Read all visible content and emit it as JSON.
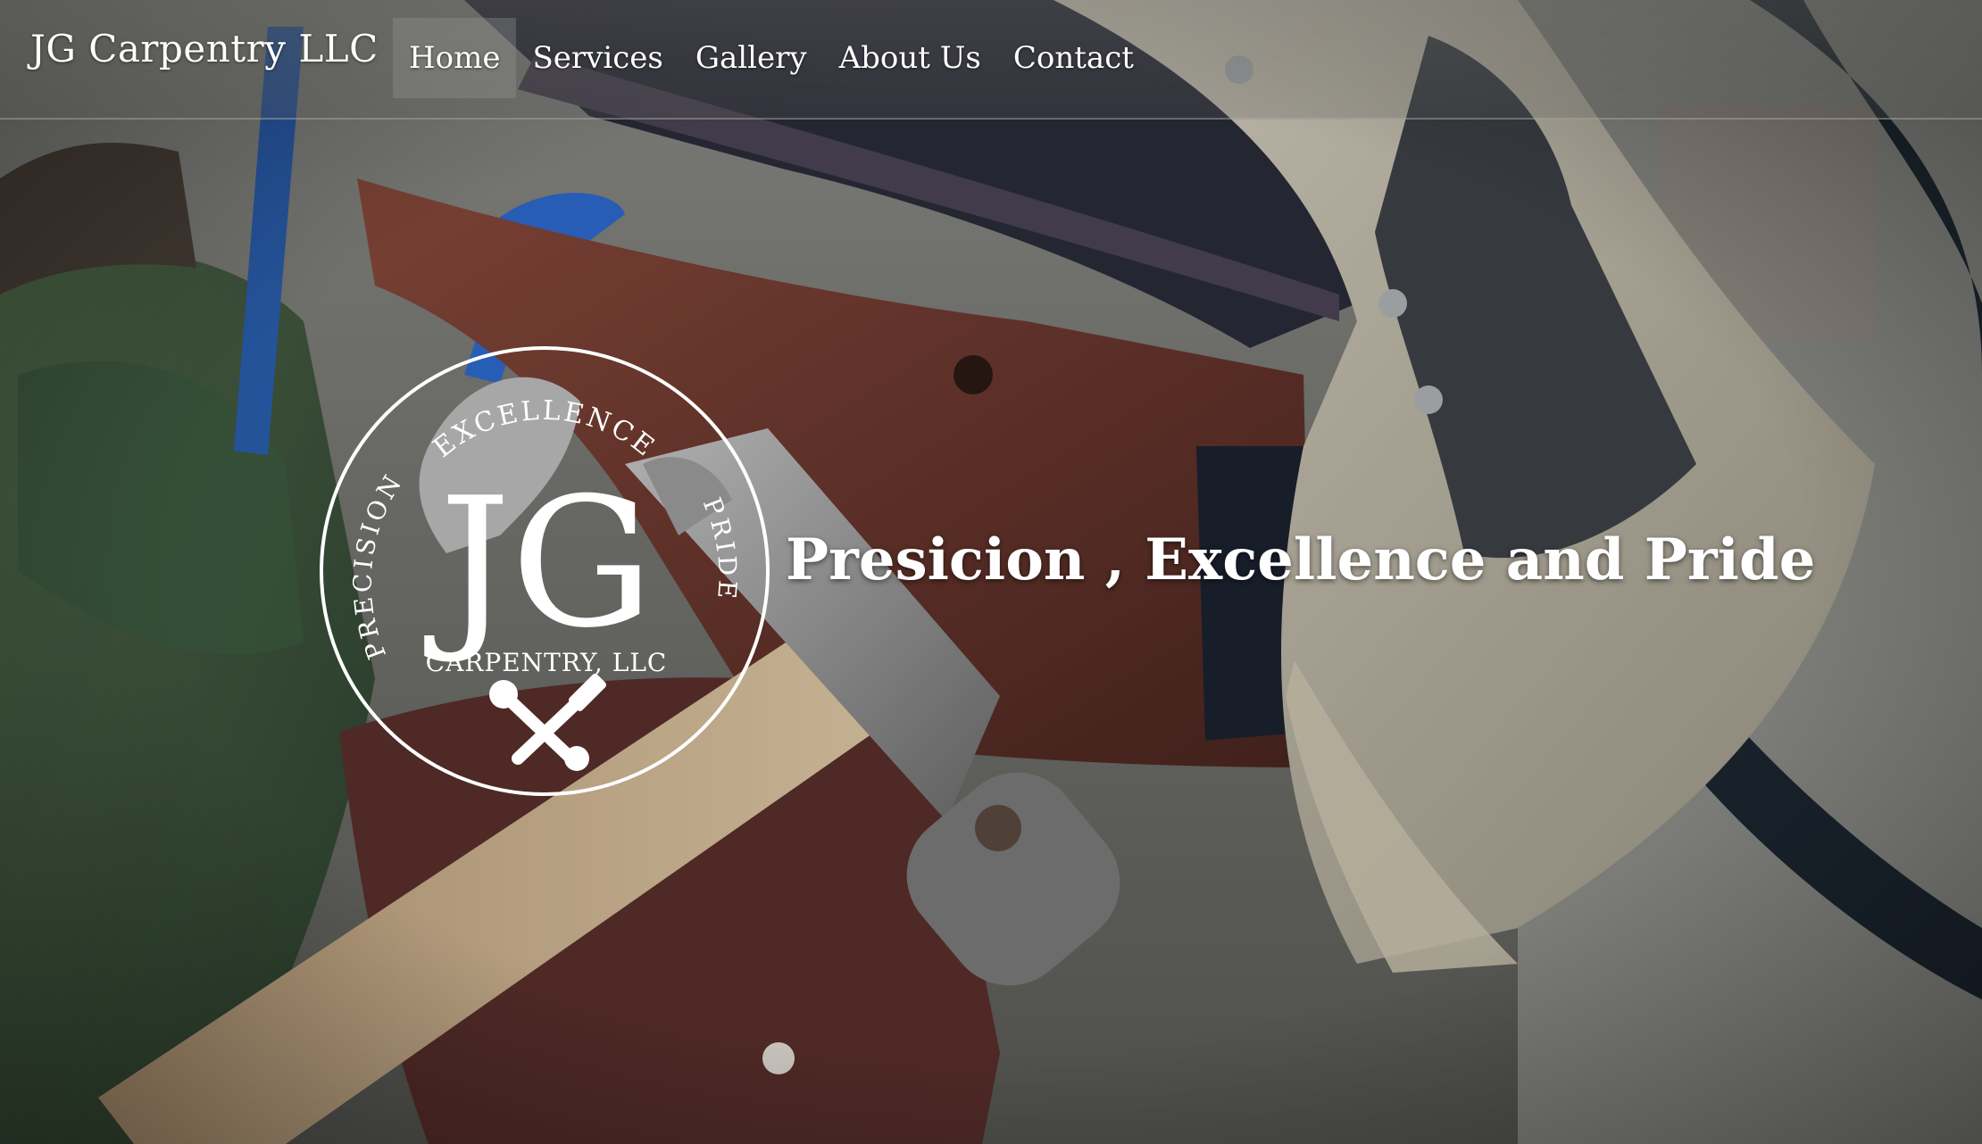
{
  "site": {
    "brand": "JG Carpentry LLC"
  },
  "nav": {
    "items": [
      {
        "label": "Home",
        "active": true
      },
      {
        "label": "Services",
        "active": false
      },
      {
        "label": "Gallery",
        "active": false
      },
      {
        "label": "About Us",
        "active": false
      },
      {
        "label": "Contact",
        "active": false
      }
    ]
  },
  "hero": {
    "tagline": "Presicion , Excellence and Pride",
    "background": "tool-belt-photo"
  },
  "logo": {
    "initials": "JG",
    "top_arc": "EXCELLENCE",
    "left_arc": "PRECISION",
    "right_arc": "PRIDE",
    "subtitle": "CARPENTRY, LLC",
    "emblem": "hammer-wrench-icon"
  },
  "colors": {
    "text": "#ffffff",
    "nav_active_bg": "#969694"
  }
}
